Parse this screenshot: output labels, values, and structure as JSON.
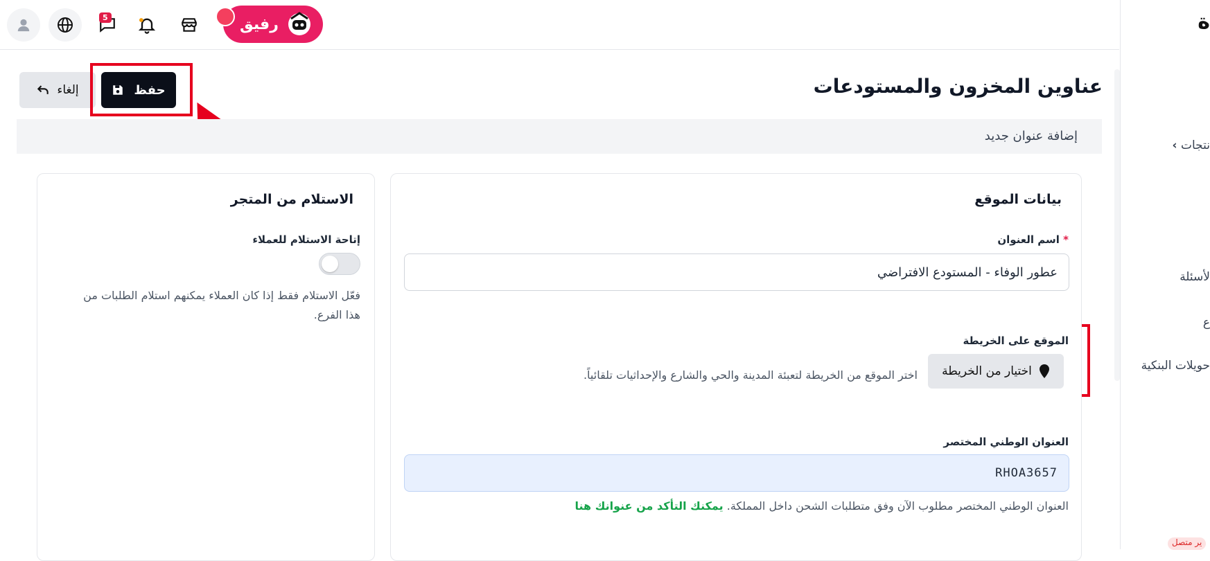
{
  "topbar": {
    "notifications_count": "5",
    "rafiq_label": "رفيق"
  },
  "sidebar": {
    "brand_letter": "ة",
    "items": [
      {
        "label": "نتجات"
      },
      {
        "label": "لأسئلة"
      },
      {
        "label": "ع"
      },
      {
        "label": "حويلات البنكية"
      }
    ],
    "status_label": "ير متصل"
  },
  "page": {
    "title": "عناوين المخزون والمستودعات",
    "save_label": "حفظ",
    "cancel_label": "إلغاء",
    "section_label": "إضافة عنوان جديد"
  },
  "location_card": {
    "title": "بيانات الموقع",
    "address_name_label": "اسم العنوان",
    "required_mark": "*",
    "address_name_value": "عطور الوفاء - المستودع الافتراضي",
    "map_label": "الموقع على الخريطة",
    "map_button_label": "اختيار من الخريطة",
    "map_help": "اختر الموقع من الخريطة لتعبئة المدينة والحي والشارع والإحداثيات تلقائياً.",
    "national_address_label": "العنوان الوطني المختصر",
    "national_address_value": "RHOA3657",
    "national_help": "العنوان الوطني المختصر مطلوب الآن وفق متطلبات الشحن داخل المملكة.",
    "national_link": "يمكنك التأكد من عنوانك هنا"
  },
  "pickup_card": {
    "title": "الاستلام من المتجر",
    "toggle_label": "إتاحة الاستلام للعملاء",
    "toggle_on": false,
    "help_line1": "فعّل الاستلام فقط إذا كان العملاء يمكنهم استلام الطلبات من",
    "help_line2": "هذا الفرع."
  },
  "colors": {
    "brand_pink": "#e91e63",
    "annotation_red": "#e6001e",
    "save_button": "#0b0f19",
    "link_green": "#16a34a"
  },
  "icons": [
    "avatar-icon",
    "globe-icon",
    "chat-icon",
    "bell-icon",
    "store-icon",
    "save-disk-icon",
    "undo-arrow-icon",
    "map-pin-icon",
    "chevron-left-icon"
  ]
}
